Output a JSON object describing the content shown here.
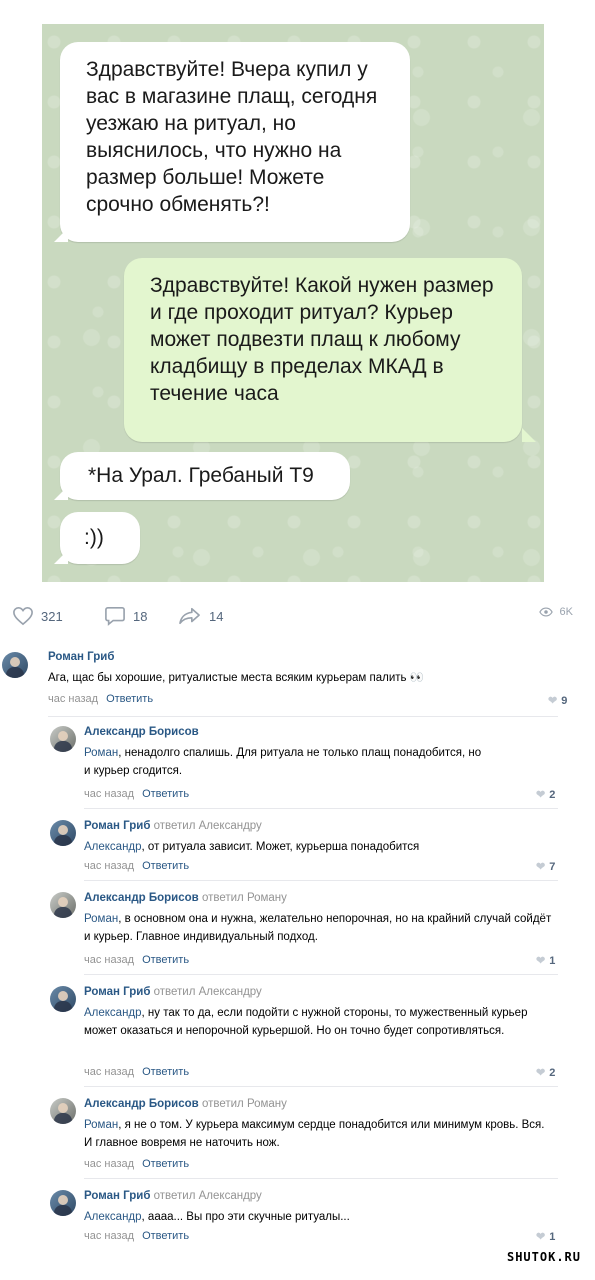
{
  "chat": {
    "messages": [
      {
        "from": "incoming",
        "text": "Здравствуйте! Вчера купил у вас в магазине плащ, сегодня уезжаю на ритуал, но выяснилось, что нужно на размер больше! Можете срочно обменять?!"
      },
      {
        "from": "outgoing",
        "text": "Здравствуйте! Какой нужен размер и где проходит ритуал? Курьер может подвезти плащ к любому кладбищу в пределах МКАД в течение часа"
      },
      {
        "from": "incoming",
        "text": "*На Урал. Гребаный Т9"
      },
      {
        "from": "incoming",
        "text": ":))"
      }
    ]
  },
  "post_stats": {
    "likes": "321",
    "comments": "18",
    "shares": "14",
    "views": "6K"
  },
  "comments": [
    {
      "author": "Роман Гриб",
      "reply_to": "",
      "addressee": "",
      "text": "Ага, щас бы хорошие, ритуалистые места всяким курьерам палить 👀",
      "time": "час назад",
      "answer_label": "Ответить",
      "likes": "9"
    },
    {
      "author": "Александр Борисов",
      "reply_to": "",
      "addressee": "Роман",
      "text": ", ненадолго спалишь. Для ритуала не только плащ понадобится, но и курьер сгодится.",
      "time": "час назад",
      "answer_label": "Ответить",
      "likes": "2"
    },
    {
      "author": "Роман Гриб",
      "reply_to": "ответил Александру",
      "addressee": "Александр",
      "text": ", от ритуала зависит. Может, курьерша понадобится",
      "time": "час назад",
      "answer_label": "Ответить",
      "likes": "7"
    },
    {
      "author": "Александр Борисов",
      "reply_to": "ответил Роману",
      "addressee": "Роман",
      "text": ", в основном она и нужна, желательно непорочная, но на крайний случай сойдёт и курьер. Главное индивидуальный подход.",
      "time": "час назад",
      "answer_label": "Ответить",
      "likes": "1"
    },
    {
      "author": "Роман Гриб",
      "reply_to": "ответил Александру",
      "addressee": "Александр",
      "text": ", ну так то да, если подойти с нужной стороны, то мужественный курьер может оказаться и непорочной курьершой. Но он точно будет сопротивляться.",
      "time": "час назад",
      "answer_label": "Ответить",
      "likes": "2"
    },
    {
      "author": "Александр Борисов",
      "reply_to": "ответил Роману",
      "addressee": "Роман",
      "text": ", я не о том. У курьера максимум сердце понадобится или минимум кровь. Вся. И главное вовремя не наточить нож.",
      "time": "час назад",
      "answer_label": "Ответить",
      "likes": ""
    },
    {
      "author": "Роман Гриб",
      "reply_to": "ответил Александру",
      "addressee": "Александр",
      "text": ", аааа... Вы про эти скучные ритуалы...",
      "time": "час назад",
      "answer_label": "Ответить",
      "likes": "1"
    }
  ],
  "watermark": "SHUTOK.RU"
}
